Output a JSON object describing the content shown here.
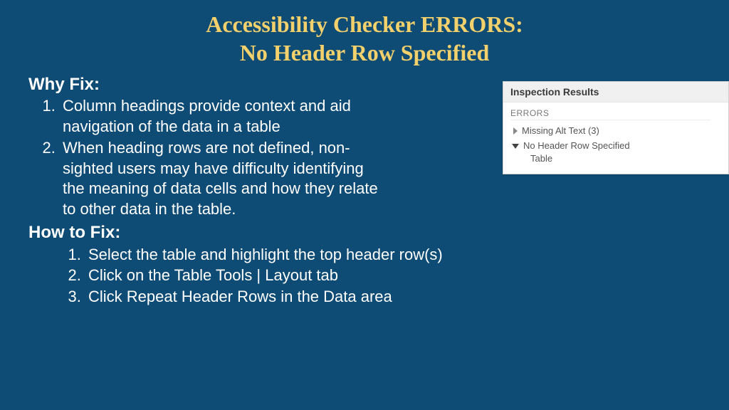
{
  "title_line1": "Accessibility Checker ERRORS:",
  "title_line2": "No Header Row Specified",
  "why_heading": "Why Fix:",
  "why_items": [
    "Column headings provide context and aid navigation of the data in a table",
    "When heading rows are not defined, non-sighted users may have difficulty identifying the meaning of data cells and how they relate to other data in the table."
  ],
  "how_heading": "How to Fix:",
  "how_items": [
    "Select the table and highlight the top header row(s)",
    "Click on the Table Tools | Layout tab",
    "Click Repeat Header Rows in the Data area"
  ],
  "panel": {
    "title": "Inspection Results",
    "section": "ERRORS",
    "row1": "Missing Alt Text (3)",
    "row2": "No Header Row Specified",
    "row2_child": "Table"
  }
}
